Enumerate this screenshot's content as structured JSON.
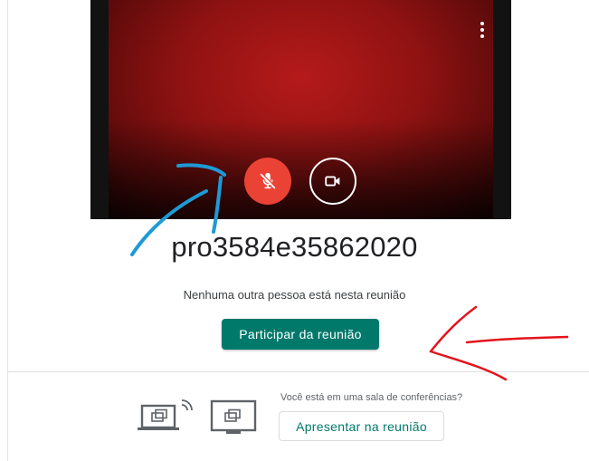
{
  "video_preview": {
    "more_options_icon": "more-vert-icon",
    "mic_button_icon": "mic-off-icon",
    "camera_button_icon": "videocam-icon",
    "mic_color": "#ea4335"
  },
  "meeting": {
    "code": "pro3584e35862020",
    "status": "Nenhuma outra pessoa está nesta reunião",
    "join_label": "Participar da reunião",
    "accent_color": "#00796b"
  },
  "room": {
    "question": "Você está em uma sala de conferências?",
    "present_label": "Apresentar na reunião",
    "icons": [
      "laptop-cast-icon",
      "monitor-cast-icon"
    ]
  },
  "annotations": {
    "blue_color": "#1e9ad6",
    "red_color": "#e3141c"
  }
}
